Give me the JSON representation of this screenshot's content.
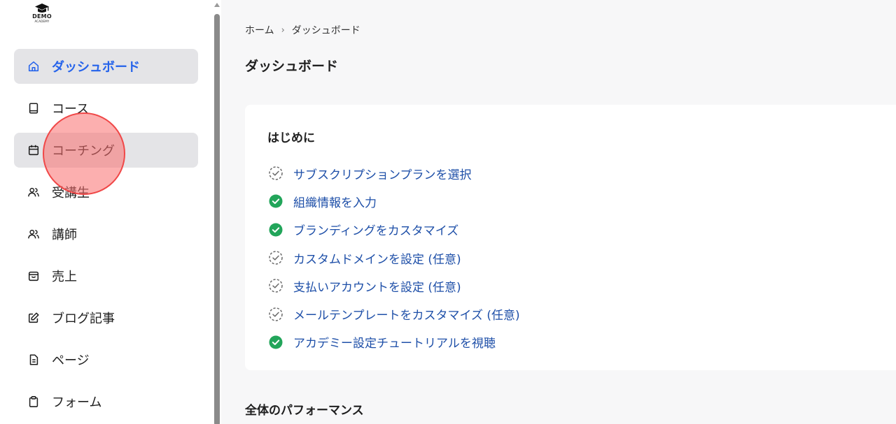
{
  "logo": {
    "brand": "DEMO",
    "sub": "ACADEMY",
    "icon": "graduation-cap-icon"
  },
  "sidebar": {
    "items": [
      {
        "label": "ダッシュボード",
        "icon": "home-icon",
        "active": true
      },
      {
        "label": "コース",
        "icon": "book-icon"
      },
      {
        "label": "コーチング",
        "icon": "calendar-icon",
        "hovered": true
      },
      {
        "label": "受講生",
        "icon": "users-icon"
      },
      {
        "label": "講師",
        "icon": "users-icon"
      },
      {
        "label": "売上",
        "icon": "shopping-bag-icon"
      },
      {
        "label": "ブログ記事",
        "icon": "edit-icon"
      },
      {
        "label": "ページ",
        "icon": "document-icon"
      },
      {
        "label": "フォーム",
        "icon": "clipboard-icon"
      }
    ]
  },
  "breadcrumb": {
    "home": "ホーム",
    "separator": "›",
    "current": "ダッシュボード"
  },
  "page": {
    "title": "ダッシュボード"
  },
  "getting_started": {
    "title": "はじめに",
    "items": [
      {
        "label": "サブスクリプションプランを選択",
        "done": false
      },
      {
        "label": "組織情報を入力",
        "done": true
      },
      {
        "label": "ブランディングをカスタマイズ",
        "done": true
      },
      {
        "label": "カスタムドメインを設定 (任意)",
        "done": false
      },
      {
        "label": "支払いアカウントを設定 (任意)",
        "done": false
      },
      {
        "label": "メールテンプレートをカスタマイズ (任意)",
        "done": false
      },
      {
        "label": "アカデミー設定チュートリアルを視聴",
        "done": true
      }
    ]
  },
  "performance": {
    "title": "全体のパフォーマンス"
  },
  "colors": {
    "accent": "#2563eb",
    "link": "#1e4fa8",
    "done": "#22a55a",
    "pending": "#6b6b6b"
  }
}
